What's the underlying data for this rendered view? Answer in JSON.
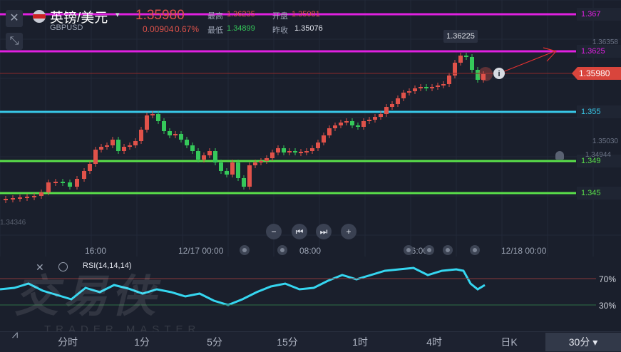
{
  "header": {
    "title": "英镑/美元",
    "symbol": "GBPUSD",
    "price": "1.35980",
    "change": "0.00904",
    "change_pct": "0.67%",
    "high_label": "最高",
    "high": "1.36235",
    "open_label": "开盘",
    "open": "1.35081",
    "low_label": "最低",
    "low": "1.34899",
    "prev_close_label": "昨收",
    "prev_close": "1.35076"
  },
  "levels": [
    {
      "label": "1.367",
      "color": "#e020e0"
    },
    {
      "label": "1.3625",
      "color": "#e020e0"
    },
    {
      "label": "1.355",
      "color": "#38c8e8"
    },
    {
      "label": "1.349",
      "color": "#5ae04a"
    },
    {
      "label": "1.345",
      "color": "#5ae04a"
    }
  ],
  "current_price_tag": "1.35980",
  "high_tooltip": "1.36225",
  "right_ticks": {
    "t1": "1.36358",
    "t2": "1.35030",
    "t3": "1.34944"
  },
  "left_tick": "1.34346",
  "xaxis": {
    "l1": "16:00",
    "l2": "12/17 00:00",
    "l3": "08:00",
    "l4": "16:00",
    "l5": "12/18 00:00"
  },
  "rsi": {
    "label": "RSI(14,14,14)",
    "upper": "70%",
    "lower": "30%"
  },
  "watermark": {
    "cn": "交易侠",
    "en": "TRADER MASTER"
  },
  "timeframes": [
    "分时",
    "1分",
    "5分",
    "15分",
    "1时",
    "4时",
    "日K",
    "30分"
  ],
  "colors": {
    "up": "#e0524a",
    "down": "#35c85a",
    "rsi_line": "#35d6f0",
    "bg": "#1a1f2c"
  },
  "chart_data": {
    "type": "candlestick",
    "note_levels": [
      1.367,
      1.3625,
      1.355,
      1.349,
      1.345
    ],
    "last_price": 1.3598,
    "high": 1.36225,
    "rsi_bounds": [
      30,
      70
    ]
  }
}
